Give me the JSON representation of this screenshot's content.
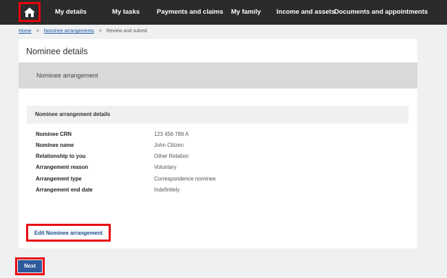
{
  "nav": {
    "home_icon": "home-icon",
    "items": [
      "My details",
      "My tasks",
      "Payments and claims",
      "My family",
      "Income and assets",
      "Documents and appointments"
    ]
  },
  "breadcrumb": {
    "home": "Home",
    "nominee": "Nominee arrangements",
    "current": "Review and submit",
    "separator": ">"
  },
  "page": {
    "title": "Nominee details",
    "section_title": "Nominee arrangement"
  },
  "details": {
    "header": "Nominee arrangement details",
    "rows": [
      {
        "label": "Nominee CRN",
        "value": "123 456 789 A"
      },
      {
        "label": "Nominee name",
        "value": "John Citizen"
      },
      {
        "label": "Relationship to you",
        "value": "Other Relation"
      },
      {
        "label": "Arrangement reason",
        "value": "Voluntary"
      },
      {
        "label": "Arrangement type",
        "value": "Correspondence nominee"
      },
      {
        "label": "Arrangement end date",
        "value": "Indefinitely"
      }
    ]
  },
  "actions": {
    "edit_label": "Edit Nominee arrangement",
    "next_label": "Next"
  },
  "colors": {
    "nav_bg": "#2b2b2b",
    "highlight": "#e8000b",
    "primary_button": "#2d5b9a",
    "link": "#1a5aa6"
  }
}
